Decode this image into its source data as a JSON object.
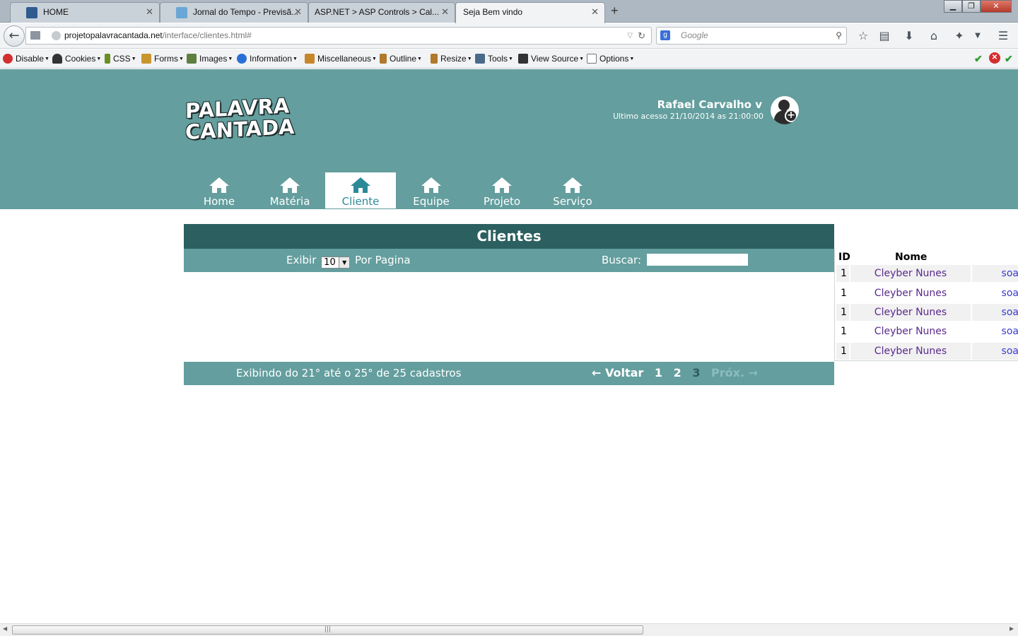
{
  "browser": {
    "tabs": [
      {
        "title": "HOME",
        "active": false
      },
      {
        "title": "Jornal do Tempo - Previsã...",
        "active": false
      },
      {
        "title": "ASP.NET > ASP Controls > Cal...",
        "active": false
      },
      {
        "title": "Seja Bem vindo",
        "active": true
      }
    ],
    "new_tab": "+",
    "url_host": "projetopalavracantada.net",
    "url_path": "/interface/clientes.html#",
    "search_placeholder": "Google",
    "toolbar_items": [
      {
        "label": "Disable",
        "icon": "disable-icon",
        "color": "#d32f2f"
      },
      {
        "label": "Cookies",
        "icon": "cookies-icon",
        "color": "#333333"
      },
      {
        "label": "CSS",
        "icon": "css-icon",
        "color": "#6b8e23"
      },
      {
        "label": "Forms",
        "icon": "forms-icon",
        "color": "#c8962c"
      },
      {
        "label": "Images",
        "icon": "images-icon",
        "color": "#5f7f3f"
      },
      {
        "label": "Information",
        "icon": "information-icon",
        "color": "#2a6fd6"
      },
      {
        "label": "Miscellaneous",
        "icon": "miscellaneous-icon",
        "color": "#c8862c"
      },
      {
        "label": "Outline",
        "icon": "outline-icon",
        "color": "#b07a2a"
      },
      {
        "label": "Resize",
        "icon": "resize-icon",
        "color": "#b07a2a"
      },
      {
        "label": "Tools",
        "icon": "tools-icon",
        "color": "#4a6a8a"
      },
      {
        "label": "View Source",
        "icon": "view-source-icon",
        "color": "#333333"
      },
      {
        "label": "Options",
        "icon": "options-icon",
        "color": "#777777"
      }
    ]
  },
  "header": {
    "logo_line1": "PALAVRA",
    "logo_line2": "CANTADA",
    "user_name": "Rafael Carvalho v",
    "last_access": "Ultimo acesso 21/10/2014 as 21:00:00"
  },
  "menu": [
    {
      "label": "Home",
      "active": false
    },
    {
      "label": "Matéria",
      "active": false
    },
    {
      "label": "Cliente",
      "active": true
    },
    {
      "label": "Equipe",
      "active": false
    },
    {
      "label": "Projeto",
      "active": false
    },
    {
      "label": "Serviço",
      "active": false
    }
  ],
  "panel": {
    "title": "Clientes",
    "show_label": "Exibir",
    "per_page_value": "10",
    "per_page_label": "Por Pagina",
    "search_label": "Buscar:",
    "footer_info": "Exibindo do 21° até o 25° de 25 cadastros",
    "pager": {
      "prev": "← Voltar",
      "pages": [
        "1",
        "2",
        "3"
      ],
      "current_page": "3",
      "next": "Próx. →"
    }
  },
  "table": {
    "headers": [
      "ID",
      "Nome"
    ],
    "rows": [
      {
        "id": "1",
        "name": "Cleyber Nunes",
        "extra": "soa"
      },
      {
        "id": "1",
        "name": "Cleyber Nunes",
        "extra": "soa"
      },
      {
        "id": "1",
        "name": "Cleyber Nunes",
        "extra": "soa"
      },
      {
        "id": "1",
        "name": "Cleyber Nunes",
        "extra": "soa"
      },
      {
        "id": "1",
        "name": "Cleyber Nunes",
        "extra": "soa"
      }
    ]
  },
  "colors": {
    "header_bg": "#649e9e",
    "panel_title_bg": "#2c5f5f",
    "menu_active_text": "#2c8a98",
    "link_purple": "#5a2a8c"
  }
}
